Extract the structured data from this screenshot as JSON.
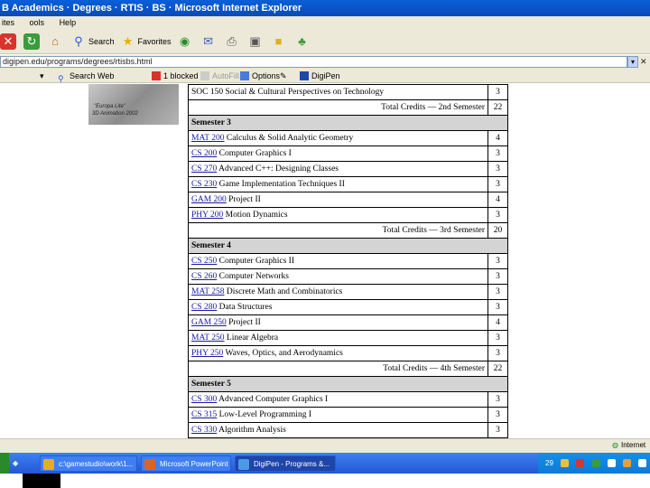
{
  "window": {
    "title": "B Academics · Degrees · RTIS · BS · Microsoft Internet Explorer"
  },
  "menu": [
    "ites",
    "ools",
    "Help"
  ],
  "toolbar": {
    "search_label": "Search",
    "favorites_label": "Favorites"
  },
  "address": {
    "url": "digipen.edu/programs/degrees/rtisbs.html"
  },
  "links": {
    "search_web": "Search Web",
    "blocked": "1 blocked",
    "autofill": "AutoFill",
    "options": "Options",
    "digipen": "DigiPen"
  },
  "banner": {
    "line1": "\"Europa Lite\"",
    "line2": "3D Animation 2002"
  },
  "courses": {
    "row_first": {
      "code": "",
      "name": "SOC 150 Social & Cultural Perspectives on Technology",
      "credits": "3"
    },
    "total2": {
      "label": "Total Credits — 2nd Semester",
      "credits": "22"
    },
    "semester3": {
      "heading": "Semester 3",
      "rows": [
        {
          "code": "MAT 200",
          "name": "Calculus & Solid Analytic Geometry",
          "credits": "4"
        },
        {
          "code": "CS 200",
          "name": "Computer Graphics I",
          "credits": "3"
        },
        {
          "code": "CS 270",
          "name": "Advanced C++: Designing Classes",
          "credits": "3"
        },
        {
          "code": "CS 230",
          "name": "Game Implementation Techniques II",
          "credits": "3"
        },
        {
          "code": "GAM 200",
          "name": "Project II",
          "credits": "4"
        },
        {
          "code": "PHY 200",
          "name": "Motion Dynamics",
          "credits": "3"
        }
      ],
      "total_label": "Total Credits — 3rd Semester",
      "total": "20"
    },
    "semester4": {
      "heading": "Semester 4",
      "rows": [
        {
          "code": "CS 250",
          "name": "Computer Graphics II",
          "credits": "3"
        },
        {
          "code": "CS 260",
          "name": "Computer Networks",
          "credits": "3"
        },
        {
          "code": "MAT 258",
          "name": "Discrete Math and Combinatorics",
          "credits": "3"
        },
        {
          "code": "CS 280",
          "name": "Data Structures",
          "credits": "3"
        },
        {
          "code": "GAM 250",
          "name": "Project II",
          "credits": "4"
        },
        {
          "code": "MAT 250",
          "name": "Linear Algebra",
          "credits": "3"
        },
        {
          "code": "PHY 250",
          "name": "Waves, Optics, and Aerodynamics",
          "credits": "3"
        }
      ],
      "total_label": "Total Credits — 4th Semester",
      "total": "22"
    },
    "semester5": {
      "heading": "Semester 5",
      "rows": [
        {
          "code": "CS 300",
          "name": "Advanced Computer Graphics I",
          "credits": "3"
        },
        {
          "code": "CS 315",
          "name": "Low-Level Programming I",
          "credits": "3"
        },
        {
          "code": "CS 330",
          "name": "Algorithm Analysis",
          "credits": "3"
        }
      ]
    }
  },
  "status": {
    "zone": "Internet"
  },
  "taskbar": {
    "items": [
      {
        "label": "c:\\gamestudio\\work\\1..."
      },
      {
        "label": "Microsoft PowerPoint ..."
      },
      {
        "label": "DigiPen - Programs &..."
      }
    ],
    "clock": "29"
  },
  "colors": {
    "title_blue": "#0b49b8",
    "link_blue": "#1a1aa8",
    "semester_gray": "#d4d4d4",
    "taskbar_blue": "#2457d4"
  }
}
